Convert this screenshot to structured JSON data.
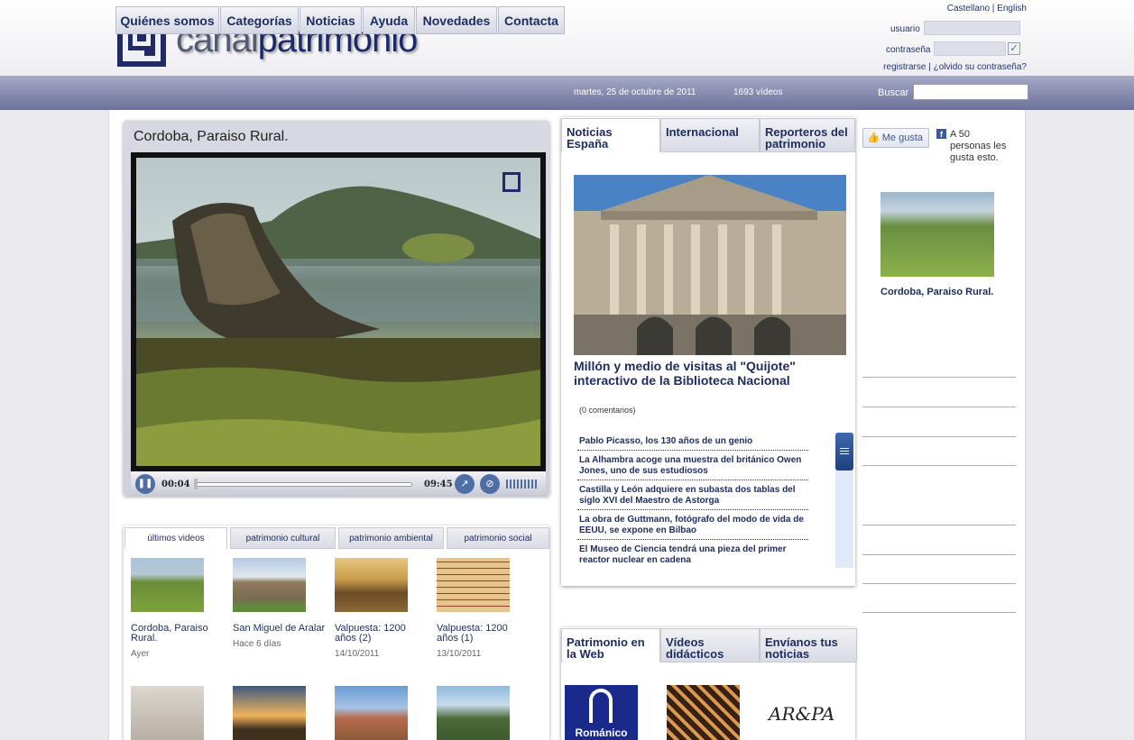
{
  "header": {
    "logo_text_light": "canal",
    "logo_text_bold": "patrimonio",
    "languages": [
      "Castellano",
      "English"
    ],
    "lang_separator": "|",
    "login": {
      "user_label": "usuario",
      "password_label": "contraseña",
      "register": "registrarse",
      "forgot": "¿olvido su contraseña?",
      "register_separator": "|"
    }
  },
  "nav": {
    "tabs": [
      "Quiénes somos",
      "Categorías",
      "Noticias",
      "Ayuda",
      "Novedades",
      "Contacta"
    ],
    "date": "martes, 25 de octubre de 2011",
    "video_count": "1693 vídeos",
    "search_label": "Buscar"
  },
  "player": {
    "title": "Cordoba, Paraiso Rural.",
    "current_time": "00:04",
    "duration": "09:45",
    "progress": 0.01
  },
  "video_tabs": {
    "tabs": [
      "últimos videos",
      "patrimonio cultural",
      "patrimonio ambiental",
      "patrimonio social"
    ],
    "active": 0,
    "items": [
      {
        "title": "Cordoba, Paraiso Rural.",
        "date": "Ayer"
      },
      {
        "title": "San Miguel de Aralar",
        "date": "Hace 6 días"
      },
      {
        "title": "Valpuesta: 1200 años (2)",
        "date": "14/10/2011"
      },
      {
        "title": "Valpuesta: 1200 años (1)",
        "date": "13/10/2011"
      }
    ]
  },
  "news": {
    "tabs": [
      "Noticias España",
      "Internacional",
      "Reporteros del patrimonio"
    ],
    "active": 0,
    "headline": "Millón y medio de visitas al \"Quijote\" interactivo de la Biblioteca Nacional",
    "comments": "(0 comentarios)",
    "items": [
      "Pablo Picasso, los 130 años de un genio",
      "La Alhambra acoge una muestra del británico Owen Jones, uno de sus estudiosos",
      "Castilla y León adquiere en subasta dos tablas del siglo XVI del Maestro de Astorga",
      "La obra de Guttmann, fotógrafo del modo de vida de EEUU, se expone en Bilbao",
      "El Museo de Ciencia tendrá una pieza del primer reactor nuclear en cadena"
    ]
  },
  "web": {
    "tabs": [
      "Patrimonio en la Web",
      "Vídeos didácticos",
      "Envíanos tus noticias"
    ],
    "active": 0,
    "logo1_text": "Románico",
    "logo3_text": "AR&PA"
  },
  "social": {
    "like_label": "Me gusta",
    "fb_letter": "f",
    "like_count_text": "A 50 personas les gusta esto."
  },
  "featured": {
    "title": "Cordoba, Paraiso Rural."
  }
}
